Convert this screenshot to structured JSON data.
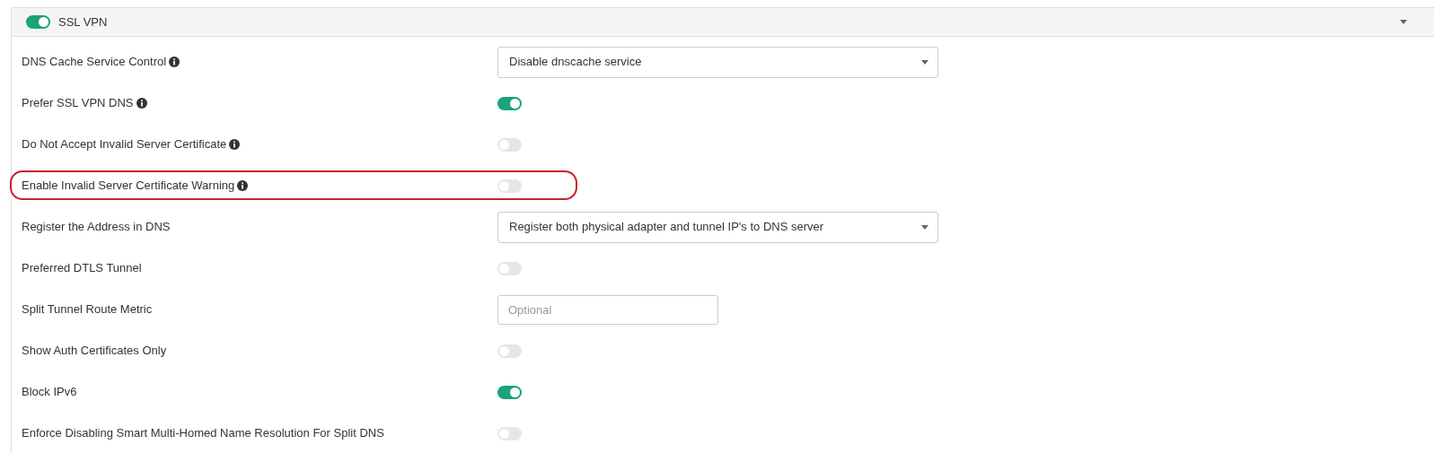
{
  "panel": {
    "title": "SSL VPN",
    "on": true,
    "expanded": true
  },
  "rows": [
    {
      "label": "DNS Cache Service Control",
      "info": true,
      "kind": "select",
      "value": "Disable dnscache service",
      "highlighted": false
    },
    {
      "label": "Prefer SSL VPN DNS",
      "info": true,
      "kind": "toggle",
      "on": true,
      "highlighted": false
    },
    {
      "label": "Do Not Accept Invalid Server Certificate",
      "info": true,
      "kind": "toggle",
      "on": false,
      "highlighted": false
    },
    {
      "label": "Enable Invalid Server Certificate Warning",
      "info": true,
      "kind": "toggle",
      "on": false,
      "highlighted": true
    },
    {
      "label": "Register the Address in DNS",
      "info": false,
      "kind": "select",
      "value": "Register both physical adapter and tunnel IP's to DNS server",
      "highlighted": false
    },
    {
      "label": "Preferred DTLS Tunnel",
      "info": false,
      "kind": "toggle",
      "on": false,
      "highlighted": false
    },
    {
      "label": "Split Tunnel Route Metric",
      "info": false,
      "kind": "input",
      "placeholder": "Optional",
      "highlighted": false
    },
    {
      "label": "Show Auth Certificates Only",
      "info": false,
      "kind": "toggle",
      "on": false,
      "highlighted": false
    },
    {
      "label": "Block IPv6",
      "info": false,
      "kind": "toggle",
      "on": true,
      "highlighted": false
    },
    {
      "label": "Enforce Disabling Smart Multi-Homed Name Resolution For Split DNS",
      "info": false,
      "kind": "toggle",
      "on": false,
      "highlighted": false
    }
  ]
}
